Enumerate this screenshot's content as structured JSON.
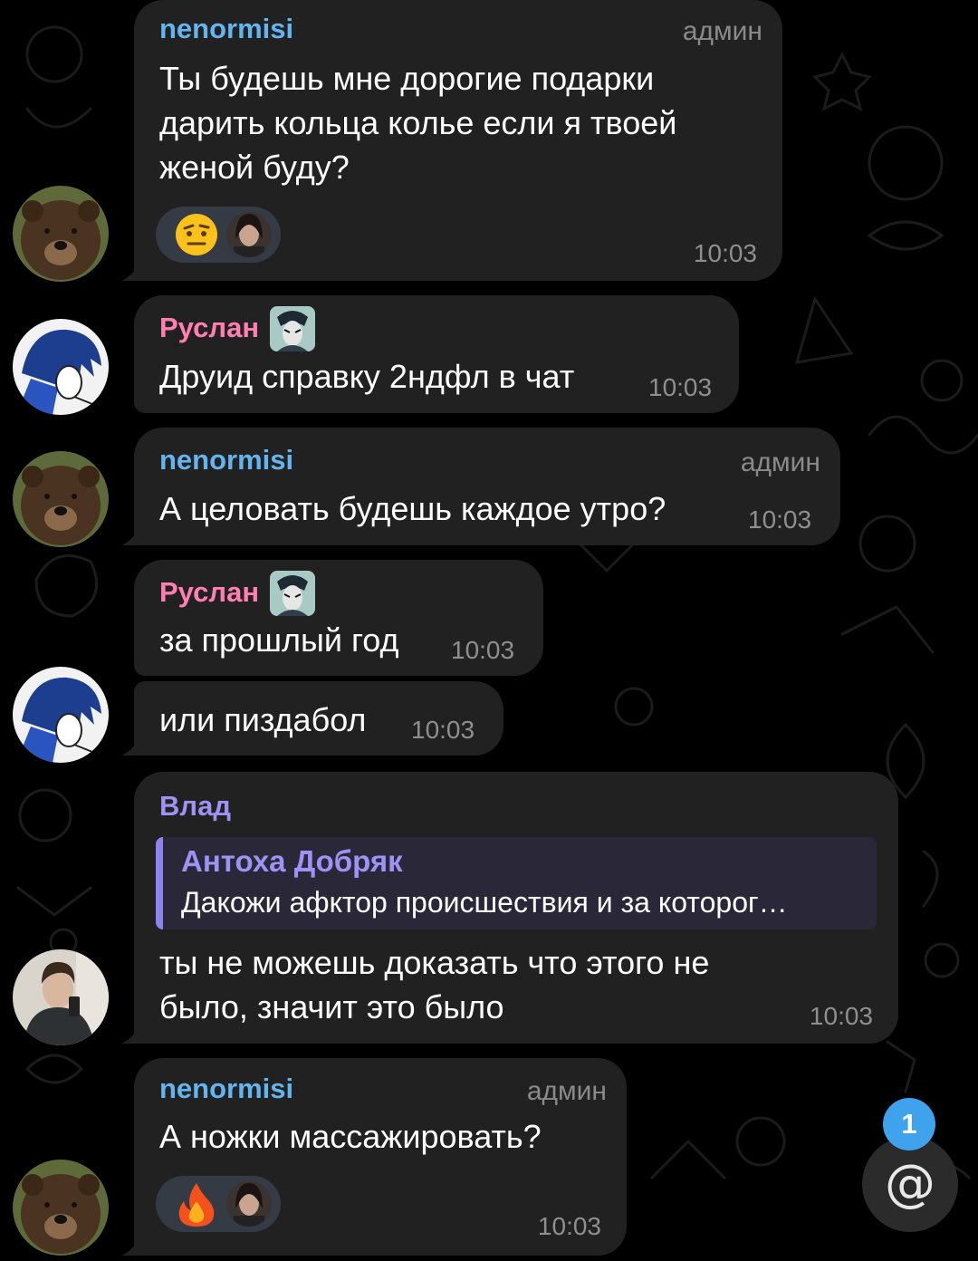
{
  "colors": {
    "background": "#000000",
    "bubble": "#212121",
    "name_nenormisi": "#64b5ef",
    "name_ruslan": "#ff7fb2",
    "name_vlad": "#9d93f5",
    "mention_badge": "#3ea3ec"
  },
  "messages": [
    {
      "sender": "nenormisi",
      "role": "админ",
      "lines": [
        "Ты будешь мне дорогие подарки",
        "дарить кольца колье если я твоей",
        "женой буду?"
      ],
      "time": "10:03",
      "reaction_emoji": "neutral-raised-eyebrow-emoji"
    },
    {
      "sender": "Руслан",
      "lines": [
        "Друид справку 2ндфл в чат"
      ],
      "time": "10:03"
    },
    {
      "sender": "nenormisi",
      "role": "админ",
      "lines": [
        "А целовать будешь каждое утро?"
      ],
      "time": "10:03"
    },
    {
      "sender": "Руслан",
      "lines": [
        "за прошлый год"
      ],
      "time": "10:03"
    },
    {
      "lines": [
        "или пиздабол"
      ],
      "time": "10:03"
    },
    {
      "sender": "Влад",
      "reply": {
        "name": "Антоха Добряк",
        "text": "Дакожи афктор происшествия и за которог…"
      },
      "lines": [
        "ты не можешь доказать что этого не",
        "было, значит это было"
      ],
      "time": "10:03"
    },
    {
      "sender": "nenormisi",
      "role": "админ",
      "lines": [
        "А ножки массажировать?"
      ],
      "time": "10:03",
      "reaction_emoji": "fire-emoji"
    }
  ],
  "mentions": {
    "count": "1",
    "icon": "@"
  }
}
